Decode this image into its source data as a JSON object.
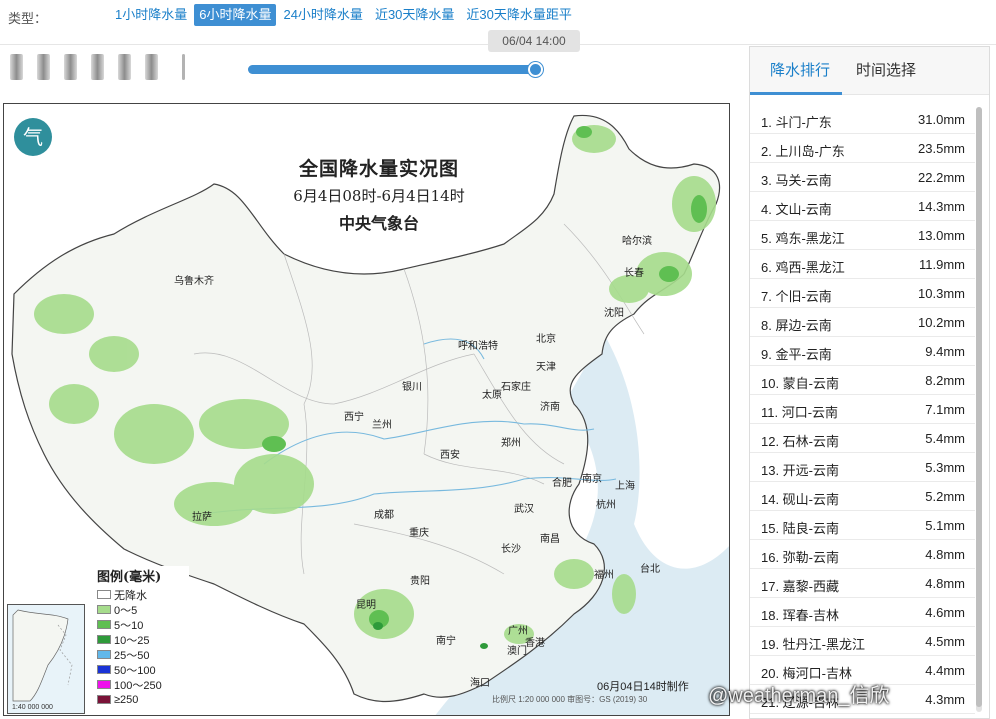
{
  "type_bar": {
    "label": "类型：",
    "tabs": [
      "1小时降水量",
      "6小时降水量",
      "24小时降水量",
      "近30天降水量",
      "近30天降水量距平"
    ],
    "active_index": 1
  },
  "playback": {
    "tooltip": "06/04 14:00",
    "progress": 1.0
  },
  "map": {
    "logo_glyph": "气",
    "title": "全国降水量实况图",
    "subtitle": "6月4日08时-6月4日14时",
    "agency": "中央气象台",
    "made_time": "06月04日14时制作",
    "footer": "比例尺 1:20 000 000   审图号：GS (2019) 30",
    "inset_scale": "1:40 000 000",
    "cities": [
      "乌鲁木齐",
      "哈尔滨",
      "长春",
      "沈阳",
      "北京",
      "天津",
      "呼和浩特",
      "银川",
      "太原",
      "石家庄",
      "西宁",
      "兰州",
      "济南",
      "西安",
      "郑州",
      "合肥",
      "南京",
      "上海",
      "成都",
      "武汉",
      "杭州",
      "重庆",
      "拉萨",
      "长沙",
      "南昌",
      "福州",
      "贵阳",
      "台北",
      "昆明",
      "南宁",
      "广州",
      "香港",
      "澳门",
      "海口"
    ],
    "legend": {
      "title": "图例(毫米)",
      "items": [
        {
          "label": "无降水",
          "color": "#ffffff"
        },
        {
          "label": "0～5",
          "color": "#a6dc8c"
        },
        {
          "label": "5～10",
          "color": "#5fbf52"
        },
        {
          "label": "10～25",
          "color": "#2e9a3a"
        },
        {
          "label": "25～50",
          "color": "#62b8ea"
        },
        {
          "label": "50～100",
          "color": "#1a33d6"
        },
        {
          "label": "100～250",
          "color": "#f010ec"
        },
        {
          "label": "≥250",
          "color": "#7a1238"
        }
      ]
    }
  },
  "panel": {
    "tabs": [
      "降水排行",
      "时间选择"
    ],
    "ranking": [
      {
        "name": "1. 斗门-广东",
        "value": "31.0mm"
      },
      {
        "name": "2. 上川岛-广东",
        "value": "23.5mm"
      },
      {
        "name": "3. 马关-云南",
        "value": "22.2mm"
      },
      {
        "name": "4. 文山-云南",
        "value": "14.3mm"
      },
      {
        "name": "5. 鸡东-黑龙江",
        "value": "13.0mm"
      },
      {
        "name": "6. 鸡西-黑龙江",
        "value": "11.9mm"
      },
      {
        "name": "7. 个旧-云南",
        "value": "10.3mm"
      },
      {
        "name": "8. 屏边-云南",
        "value": "10.2mm"
      },
      {
        "name": "9. 金平-云南",
        "value": "9.4mm"
      },
      {
        "name": "10. 蒙自-云南",
        "value": "8.2mm"
      },
      {
        "name": "11. 河口-云南",
        "value": "7.1mm"
      },
      {
        "name": "12. 石林-云南",
        "value": "5.4mm"
      },
      {
        "name": "13. 开远-云南",
        "value": "5.3mm"
      },
      {
        "name": "14. 砚山-云南",
        "value": "5.2mm"
      },
      {
        "name": "15. 陆良-云南",
        "value": "5.1mm"
      },
      {
        "name": "16. 弥勒-云南",
        "value": "4.8mm"
      },
      {
        "name": "17. 嘉黎-西藏",
        "value": "4.8mm"
      },
      {
        "name": "18. 珲春-吉林",
        "value": "4.6mm"
      },
      {
        "name": "19. 牡丹江-黑龙江",
        "value": "4.5mm"
      },
      {
        "name": "20. 梅河口-吉林",
        "value": "4.4mm"
      },
      {
        "name": "21. 辽源-吉林",
        "value": "4.3mm"
      }
    ]
  },
  "watermark": "@weatherman_信欣"
}
